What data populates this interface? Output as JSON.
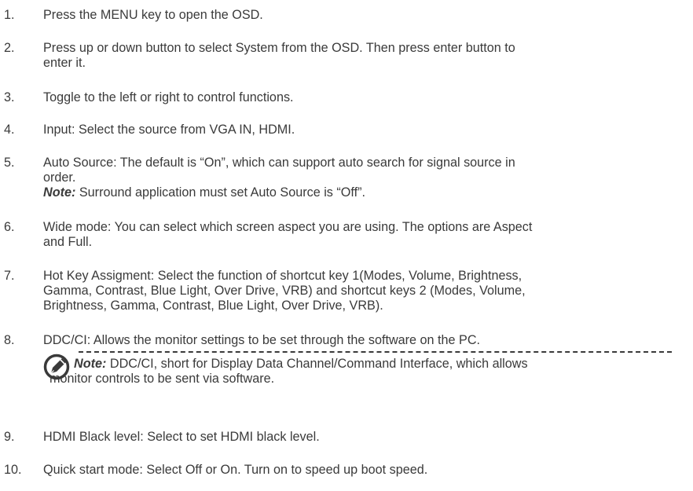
{
  "items": [
    {
      "num": "1.",
      "text": "Press the MENU key to open the OSD."
    },
    {
      "num": "2.",
      "line1": "Press up or down button to select System from the OSD. Then press enter button to",
      "line2": "enter it."
    },
    {
      "num": "3.",
      "text": "Toggle to the left or right to control functions."
    },
    {
      "num": "4.",
      "text": "Input: Select the source from VGA IN, HDMI."
    },
    {
      "num": "5.",
      "line1": "Auto Source: The default is “On”, which can support auto search for signal source in",
      "line2": "order.",
      "note_label": "Note:",
      "note_text": " Surround application must set Auto Source is “Off”."
    },
    {
      "num": "6.",
      "line1": "Wide mode: You can select which screen aspect you are using. The options are Aspect",
      "line2": "and Full."
    },
    {
      "num": "7.",
      "line1": "Hot Key Assigment: Select the function of shortcut key 1(Modes, Volume, Brightness,",
      "line2": "Gamma, Contrast, Blue Light, Over Drive, VRB) and shortcut keys 2 (Modes, Volume,",
      "line3": "Brightness, Gamma, Contrast, Blue Light, Over Drive, VRB)."
    },
    {
      "num": "8.",
      "text": "DDC/CI: Allows the monitor settings to be set through the software on the PC.",
      "note_label": "Note:",
      "note_line1": " DDC/CI, short for Display Data Channel/Command Interface, which allows",
      "note_line2": "monitor controls to be sent via software."
    },
    {
      "num": "9.",
      "text": "HDMI Black level: Select to set HDMI black level."
    },
    {
      "num": "10.",
      "text": "Quick start mode: Select Off or On. Turn on to speed up boot speed."
    }
  ],
  "icons": {
    "note": "pencil-note-icon"
  },
  "colors": {
    "text": "#3a3a3a"
  }
}
